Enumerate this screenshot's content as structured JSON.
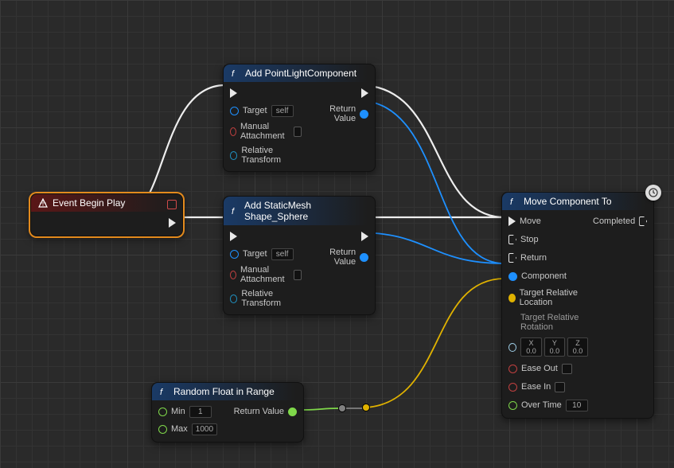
{
  "nodes": {
    "begin": {
      "title": "Event Begin Play"
    },
    "addLight": {
      "title": "Add PointLightComponent",
      "pins": {
        "target": "Target",
        "self": "self",
        "manual": "Manual Attachment",
        "relTrans": "Relative Transform",
        "retval": "Return Value"
      }
    },
    "addMesh": {
      "title": "Add StaticMesh Shape_Sphere",
      "pins": {
        "target": "Target",
        "self": "self",
        "manual": "Manual Attachment",
        "relTrans": "Relative Transform",
        "retval": "Return Value"
      }
    },
    "move": {
      "title": "Move Component To",
      "pins": {
        "move": "Move",
        "completed": "Completed",
        "stop": "Stop",
        "return": "Return",
        "component": "Component",
        "targetLoc": "Target Relative Location",
        "targetRot": "Target Relative Rotation",
        "rotX": "X 0.0",
        "rotY": "Y 0.0",
        "rotZ": "Z 0.0",
        "easeOut": "Ease Out",
        "easeIn": "Ease In",
        "overTime": "Over Time",
        "overTimeVal": "10"
      }
    },
    "rand": {
      "title": "Random Float in Range",
      "pins": {
        "min": "Min",
        "minVal": "1",
        "max": "Max",
        "maxVal": "1000",
        "retval": "Return Value"
      }
    }
  }
}
